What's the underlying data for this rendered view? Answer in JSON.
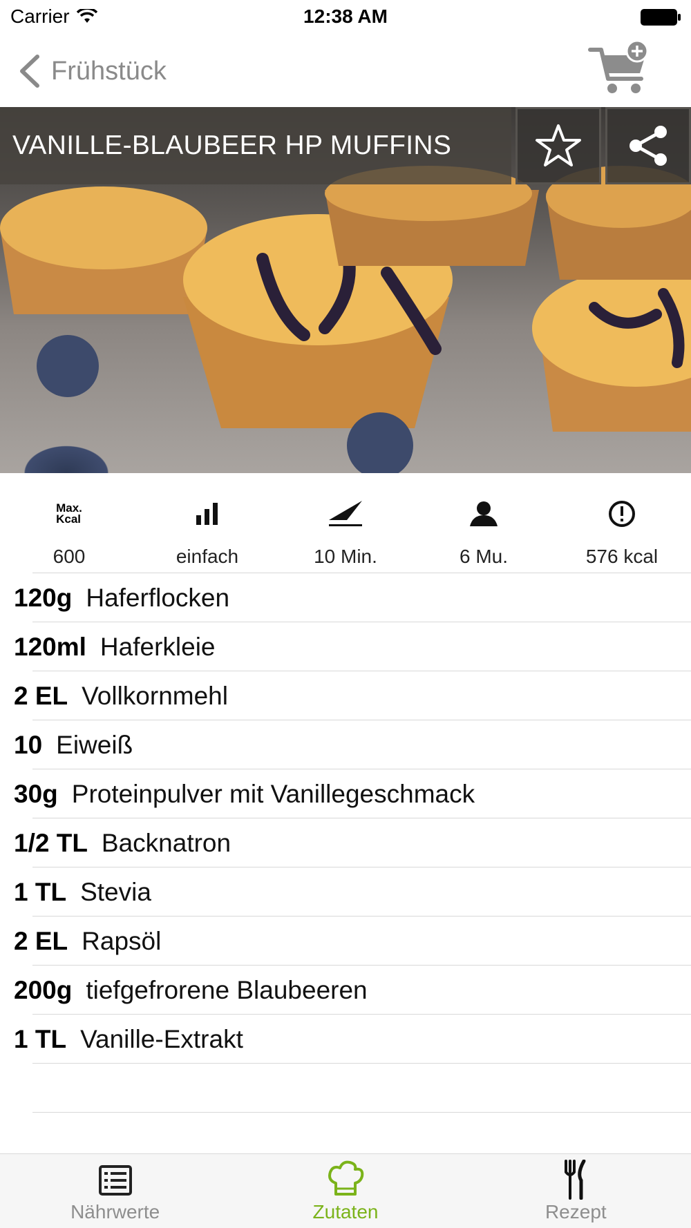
{
  "status_bar": {
    "carrier": "Carrier",
    "time": "12:38 AM"
  },
  "nav": {
    "back_label": "Frühstück",
    "back_icon": "chevron-left-icon",
    "cart_icon": "cart-plus-icon"
  },
  "recipe": {
    "title": "VANILLE-BLAUBEER HP MUFFINS",
    "favorite_icon": "star-icon",
    "share_icon": "share-icon"
  },
  "info": [
    {
      "icon": "max-kcal-icon",
      "icon_text": "Max.\nKcal",
      "value": "600"
    },
    {
      "icon": "difficulty-bars-icon",
      "value": "einfach"
    },
    {
      "icon": "knife-icon",
      "value": "10 Min."
    },
    {
      "icon": "person-icon",
      "value": "6 Mu."
    },
    {
      "icon": "alert-circle-icon",
      "value": "576 kcal"
    }
  ],
  "ingredients": [
    {
      "qty": "120g",
      "name": "Haferflocken"
    },
    {
      "qty": "120ml",
      "name": "Haferkleie"
    },
    {
      "qty": "2 EL",
      "name": "Vollkornmehl"
    },
    {
      "qty": "10",
      "name": "Eiweiß"
    },
    {
      "qty": "30g",
      "name": "Proteinpulver mit Vanillegeschmack"
    },
    {
      "qty": "1/2 TL",
      "name": "Backnatron"
    },
    {
      "qty": "1 TL",
      "name": "Stevia"
    },
    {
      "qty": "2 EL",
      "name": "Rapsöl"
    },
    {
      "qty": "200g",
      "name": "tiefgefrorene Blaubeeren"
    },
    {
      "qty": "1 TL",
      "name": "Vanille-Extrakt"
    }
  ],
  "tabs": [
    {
      "label": "Nährwerte",
      "icon": "list-icon",
      "active": false
    },
    {
      "label": "Zutaten",
      "icon": "chef-hat-icon",
      "active": true
    },
    {
      "label": "Rezept",
      "icon": "fork-knife-icon",
      "active": false
    }
  ],
  "colors": {
    "accent": "#7bb31a",
    "muted": "#8e8e8e",
    "divider": "#d8d8d8"
  }
}
